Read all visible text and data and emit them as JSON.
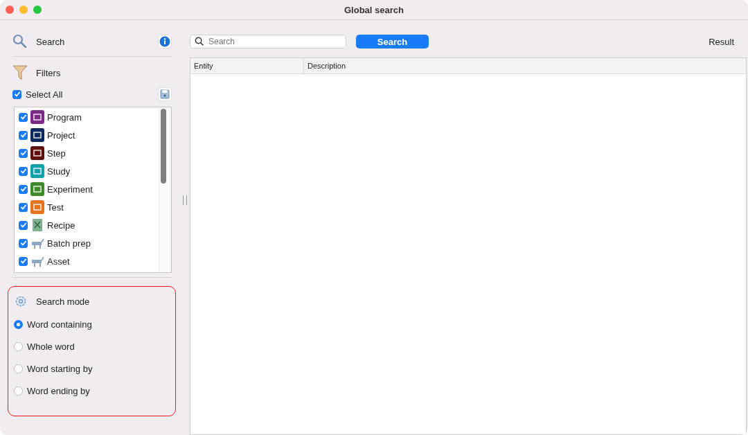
{
  "window": {
    "title": "Global search"
  },
  "search_section": {
    "label": "Search"
  },
  "filters": {
    "label": "Filters",
    "select_all": {
      "label": "Select All",
      "checked": true
    },
    "items": [
      {
        "label": "Program",
        "checked": true,
        "kind": "tile",
        "color": "#7b2a86"
      },
      {
        "label": "Project",
        "checked": true,
        "kind": "tile",
        "color": "#0d2a5c"
      },
      {
        "label": "Step",
        "checked": true,
        "kind": "tile",
        "color": "#5e0f0f"
      },
      {
        "label": "Study",
        "checked": true,
        "kind": "tile",
        "color": "#14a0a8"
      },
      {
        "label": "Experiment",
        "checked": true,
        "kind": "tile",
        "color": "#3f8b2a"
      },
      {
        "label": "Test",
        "checked": true,
        "kind": "tile",
        "color": "#e8731e"
      },
      {
        "label": "Recipe",
        "checked": true,
        "kind": "book",
        "color": "#7fb08f"
      },
      {
        "label": "Batch prep",
        "checked": true,
        "kind": "outline",
        "color": "#8fa6c2"
      },
      {
        "label": "Asset",
        "checked": true,
        "kind": "outline",
        "color": "#8fa6c2"
      }
    ]
  },
  "search_mode": {
    "label": "Search mode",
    "options": [
      {
        "label": "Word containing",
        "selected": true
      },
      {
        "label": "Whole word",
        "selected": false
      },
      {
        "label": "Word starting by",
        "selected": false
      },
      {
        "label": "Word ending by",
        "selected": false
      }
    ]
  },
  "search_bar": {
    "placeholder": "Search",
    "button": "Search",
    "result_label": "Result"
  },
  "table": {
    "columns": [
      "Entity",
      "Description"
    ]
  }
}
